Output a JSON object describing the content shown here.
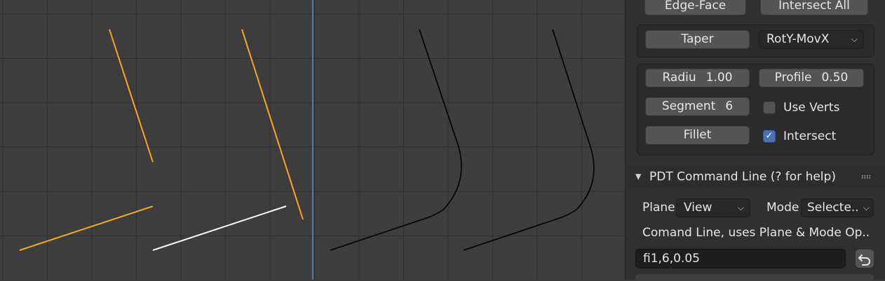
{
  "viewport": {
    "colors": {
      "background": "#3d3d3d",
      "grid": "#2f2f2f",
      "axis": "#4a7ac8",
      "selected": "#f5a623",
      "active": "#ffffff",
      "curve": "#000000"
    }
  },
  "panel": {
    "edge_face_label": "Edge-Face",
    "intersect_all_label": "Intersect All",
    "taper_label": "Taper",
    "taper_mode_value": "RotY-MovX",
    "radius_label": "Radiu",
    "radius_value": "1.00",
    "profile_label": "Profile",
    "profile_value": "0.50",
    "segment_label": "Segment",
    "segment_value": "6",
    "use_verts_label": "Use Verts",
    "use_verts_checked": false,
    "fillet_label": "Fillet",
    "intersect_label": "Intersect",
    "intersect_checked": true,
    "command_line": {
      "title": "PDT Command Line (? for help)",
      "plane_label": "Plane",
      "plane_value": "View",
      "mode_label": "Mode",
      "mode_value": "Selecte..",
      "description": "Comand Line, uses Plane & Mode Op..",
      "input_value": "fi1,6,0.05"
    },
    "icons": [
      "chevron-down-icon",
      "checkbox-icon",
      "checkmark-icon",
      "disclosure-triangle-icon",
      "drag-grip-icon",
      "undo-arrow-icon"
    ]
  }
}
